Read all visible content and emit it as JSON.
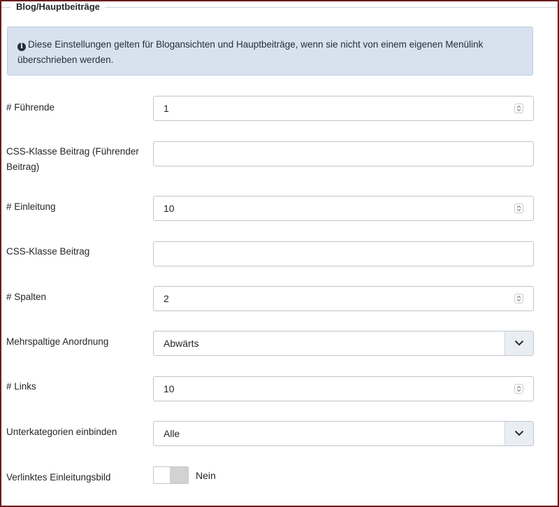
{
  "section": {
    "legend": "Blog/Hauptbeiträge",
    "info_line1": "Diese Einstellungen gelten für Blogansichten und Hauptbeiträge, wenn sie nicht von einem eigenen Menülink",
    "info_line2": "überschrieben werden."
  },
  "fields": {
    "leading": {
      "label": "# Führende",
      "value": "1"
    },
    "leading_css_line1": "CSS-Klasse Beitrag (Führender",
    "leading_css_line2": "Beitrag)",
    "leading_css_value": "",
    "intro": {
      "label": "# Einleitung",
      "value": "10"
    },
    "intro_css": {
      "label": "CSS-Klasse Beitrag",
      "value": ""
    },
    "columns": {
      "label": "# Spalten",
      "value": "2"
    },
    "multi_column_order": {
      "label": "Mehrspaltige Anordnung",
      "selected": "Abwärts"
    },
    "links": {
      "label": "# Links",
      "value": "10"
    },
    "subcategories": {
      "label": "Unterkategorien einbinden",
      "selected": "Alle"
    },
    "linked_intro_image": {
      "label": "Verlinktes Einleitungsbild",
      "state": "Nein"
    }
  },
  "icons": {
    "info": "info-circle-icon",
    "spinner": "spinner-arrows-icon",
    "dropdown": "chevron-down-icon"
  },
  "colors": {
    "frame": "#6b1d1d",
    "alert_bg": "#d8e2ef",
    "input_border": "#bfc6ce",
    "toggle_off": "#d2d2d2"
  }
}
